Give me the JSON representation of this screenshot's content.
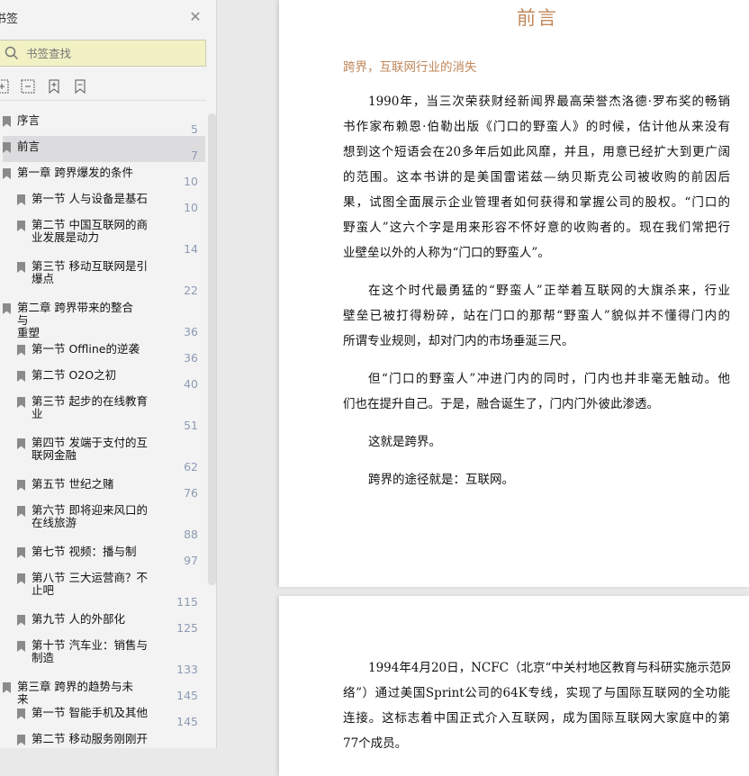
{
  "sidebar": {
    "title": "书签",
    "search_placeholder": "书签查找",
    "items": [
      {
        "label": "序言",
        "page": "5",
        "level": 1
      },
      {
        "label": "前言",
        "page": "7",
        "level": 1,
        "selected": true
      },
      {
        "label": "第一章 跨界爆发的条件",
        "page": "10",
        "level": 1
      },
      {
        "label": "第一节 人与设备是基石",
        "page": "10",
        "level": 2
      },
      {
        "label": "第二节 中国互联网的商\n业发展是动力",
        "page": "14",
        "level": 2
      },
      {
        "label": "第三节 移动互联网是引\n爆点",
        "page": "22",
        "level": 2
      },
      {
        "label": "第二章 跨界带来的整合与\n重塑",
        "page": "36",
        "level": 1
      },
      {
        "label": "第一节 Offline的逆袭",
        "page": "36",
        "level": 2
      },
      {
        "label": "第二节 O2O之初",
        "page": "40",
        "level": 2
      },
      {
        "label": "第三节 起步的在线教育\n业",
        "page": "51",
        "level": 2
      },
      {
        "label": "第四节 发端于支付的互\n联网金融",
        "page": "62",
        "level": 2
      },
      {
        "label": "第五节 世纪之赌",
        "page": "76",
        "level": 2
      },
      {
        "label": "第六节 即将迎来风口的\n在线旅游",
        "page": "88",
        "level": 2
      },
      {
        "label": "第七节 视频：播与制",
        "page": "97",
        "level": 2
      },
      {
        "label": "第八节 三大运营商？不\n止吧",
        "page": "115",
        "level": 2
      },
      {
        "label": "第九节 人的外部化",
        "page": "125",
        "level": 2
      },
      {
        "label": "第十节 汽车业：销售与\n制造",
        "page": "133",
        "level": 2
      },
      {
        "label": "第三章 跨界的趋势与未来",
        "page": "145",
        "level": 1
      },
      {
        "label": "第一节 智能手机及其他",
        "page": "145",
        "level": 2
      },
      {
        "label": "第二节 移动服务刚刚开",
        "page": "",
        "level": 2
      }
    ]
  },
  "doc": {
    "title": "前言",
    "subtitle": "跨界，互联网行业的消失",
    "paragraphs": [
      [
        "1990年，当三次荣获财经新闻界最高荣誉杰洛德·罗布奖的畅销",
        "书作家布赖恩·伯勒出版《门口的野蛮人》的时候，估计他从来没有",
        "想到这个短语会在20多年后如此风靡，并且，用意已经扩大到更广阔",
        "的范围。这本书讲的是美国雷诺兹—纳贝斯克公司被收购的前因后",
        "果，试图全面展示企业管理者如何获得和掌握公司的股权。“门口的",
        "野蛮人”这六个字是用来形容不怀好意的收购者的。现在我们常把行",
        "业壁垒以外的人称为“门口的野蛮人”。"
      ],
      [
        "在这个时代最勇猛的“野蛮人”正举着互联网的大旗杀来，行业",
        "壁垒已被打得粉碎，站在门口的那帮“野蛮人”貌似并不懂得门内的",
        "所谓专业规则，却对门内的市场垂涎三尺。"
      ],
      [
        "但“门口的野蛮人”冲进门内的同时，门内也并非毫无触动。他",
        "们也在提升自己。于是，融合诞生了，门内门外彼此渗透。"
      ],
      [
        "这就是跨界。"
      ],
      [
        "跨界的途径就是：互联网。"
      ]
    ],
    "page2_paragraphs": [
      [
        "1994年4月20日，NCFC（北京“中关村地区教育与科研实施示范网",
        "络”）通过美国Sprint公司的64K专线，实现了与国际互联网的全功能",
        "连接。这标志着中国正式介入互联网，成为国际互联网大家庭中的第",
        "77个成员。"
      ]
    ]
  }
}
